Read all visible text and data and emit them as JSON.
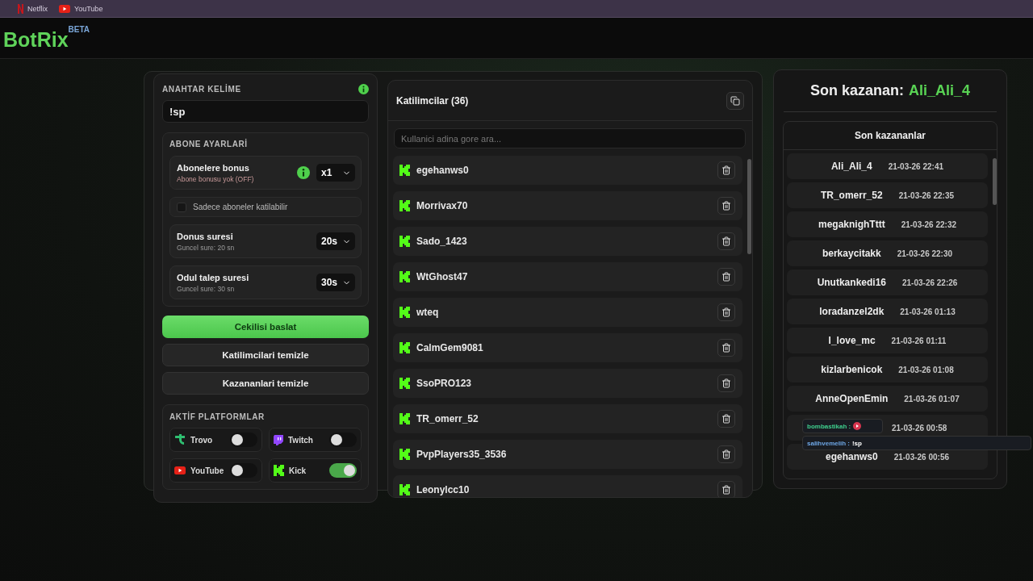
{
  "bookmarks": [
    {
      "kind": "netflix",
      "label": "Netflix"
    },
    {
      "kind": "youtube",
      "label": "YouTube"
    }
  ],
  "logo": {
    "name": "BotRix",
    "badge": "BETA"
  },
  "settings": {
    "keyword_label": "ANAHTAR KELİME",
    "keyword": "!sp",
    "subscriber_title": "ABONE AYARLARİ",
    "bonus": {
      "title": "Abonelere bonus",
      "subtitle": "Abone bonusu yok (OFF)",
      "value": "x1"
    },
    "subscribers_only": {
      "label": "Sadece aboneler katilabilir",
      "checked": false
    },
    "timers": [
      {
        "title": "Donus suresi",
        "subtitle": "Guncel sure: 20 sn",
        "value": "20s"
      },
      {
        "title": "Odul talep suresi",
        "subtitle": "Guncel sure: 30 sn",
        "value": "30s"
      }
    ]
  },
  "actions": [
    {
      "kind": "primary",
      "label": "Cekilisi baslat"
    },
    {
      "kind": "secondary",
      "label": "Katilimcilari temizle"
    },
    {
      "kind": "secondary",
      "label": "Kazananlari temizle"
    }
  ],
  "platforms": {
    "title": "AKTİF PLATFORMLAR",
    "items": [
      {
        "kind": "trovo",
        "label": "Trovo",
        "on": false
      },
      {
        "kind": "twitch",
        "label": "Twitch",
        "on": false
      },
      {
        "kind": "youtube",
        "label": "YouTube",
        "on": false
      },
      {
        "kind": "kick",
        "label": "Kick",
        "on": true
      }
    ]
  },
  "participants": {
    "title": "Katilimcilar (36)",
    "search_placeholder": "Kullanici adina gore ara...",
    "rows": [
      {
        "name": "egehanws0"
      },
      {
        "name": "Morrivax70"
      },
      {
        "name": "Sado_1423"
      },
      {
        "name": "WtGhost47"
      },
      {
        "name": "wteq"
      },
      {
        "name": "CalmGem9081"
      },
      {
        "name": "SsoPRO123"
      },
      {
        "name": "TR_omerr_52"
      },
      {
        "name": "PvpPlayers35_3536"
      },
      {
        "name": "Leonylcc10"
      }
    ]
  },
  "winner": {
    "label": "Son kazanan:",
    "name": "Ali_Ali_4"
  },
  "recent": {
    "title": "Son kazananlar",
    "rows": [
      {
        "name": "Ali_Ali_4",
        "time": "21-03-26 22:41"
      },
      {
        "name": "TR_omerr_52",
        "time": "21-03-26 22:35"
      },
      {
        "name": "megaknighTttt",
        "time": "21-03-26 22:32"
      },
      {
        "name": "berkaycitakk",
        "time": "21-03-26 22:30"
      },
      {
        "name": "Unutkankedi16",
        "time": "21-03-26 22:26"
      },
      {
        "name": "loradanzel2dk",
        "time": "21-03-26 01:13"
      },
      {
        "name": "I_love_mc",
        "time": "21-03-26 01:11"
      },
      {
        "name": "kizlarbenicok",
        "time": "21-03-26 01:08"
      },
      {
        "name": "AnneOpenEmin",
        "time": "21-03-26 01:07"
      },
      {
        "time": "21-03-26 00:58"
      },
      {
        "name": "egehanws0",
        "time": "21-03-26 00:56"
      }
    ]
  },
  "chat": [
    {
      "kind": "emote",
      "user": "bombastikah :"
    },
    {
      "kind": "text",
      "user": "salihvemelih :",
      "text": "!sp"
    }
  ]
}
